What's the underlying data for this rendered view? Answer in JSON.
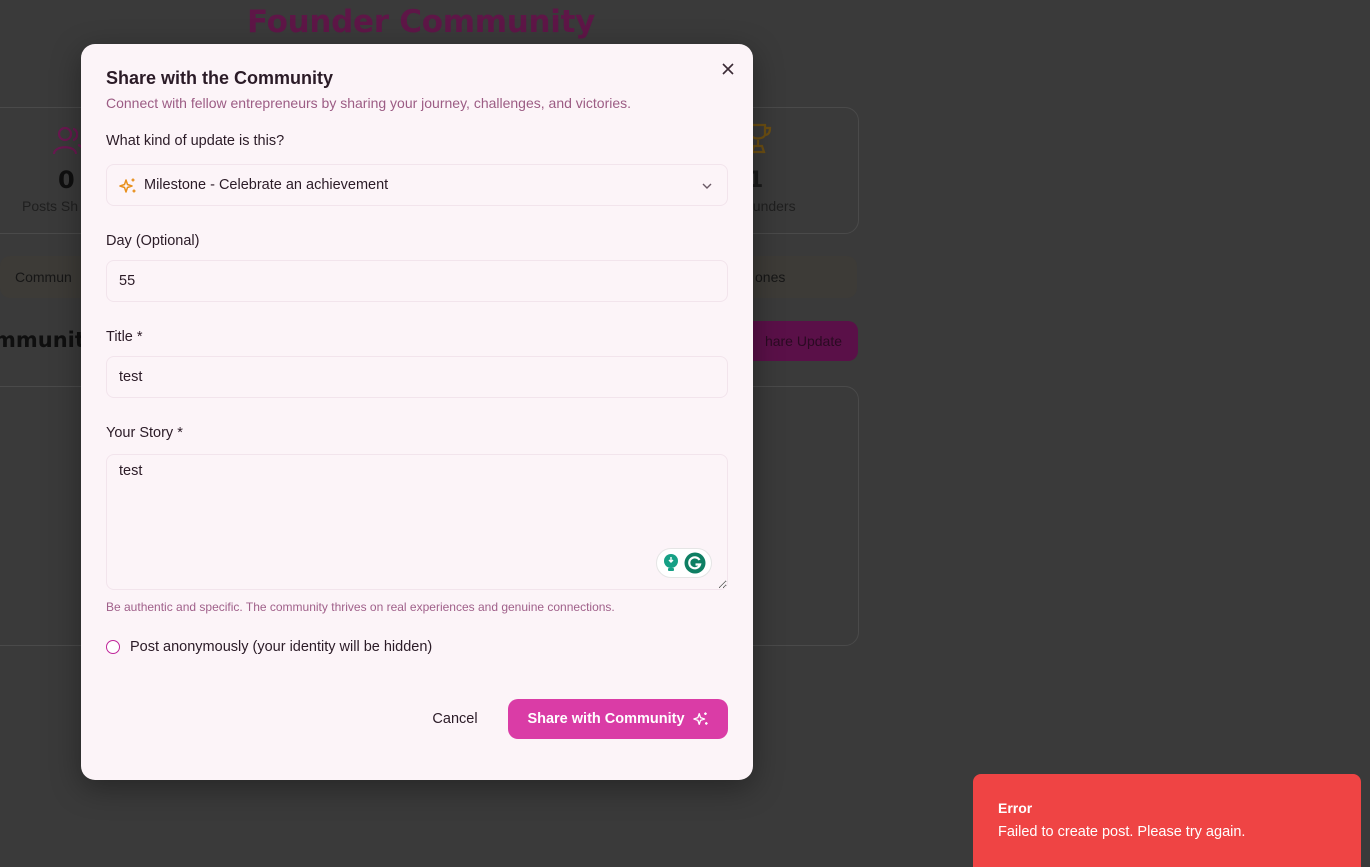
{
  "background": {
    "page_title": "Founder Community",
    "stats": {
      "left_value": "0",
      "left_label": "Posts Sh",
      "right_value": "1",
      "right_label": "ounders"
    },
    "tabs": {
      "left_label": "Commun",
      "right_label": "ones"
    },
    "section_title": "mmunity",
    "share_update_label": "hare Update"
  },
  "modal": {
    "title": "Share with the Community",
    "subtitle": "Connect with fellow entrepreneurs by sharing your journey, challenges, and victories.",
    "close_icon": "close-icon",
    "update_type": {
      "label": "What kind of update is this?",
      "selected": "Milestone - Celebrate an achievement",
      "icon": "sparkles-icon"
    },
    "day": {
      "label": "Day (Optional)",
      "value": "55"
    },
    "title_field": {
      "label": "Title *",
      "value": "test"
    },
    "story": {
      "label": "Your Story *",
      "value": "test"
    },
    "hint": "Be authentic and specific. The community thrives on real experiences and genuine connections.",
    "anonymous_label": "Post anonymously (your identity will be hidden)",
    "cancel_label": "Cancel",
    "submit_label": "Share with Community"
  },
  "toast": {
    "title": "Error",
    "message": "Failed to create post. Please try again."
  },
  "colors": {
    "accent": "#da3ca6",
    "modal_bg": "#fcf4f8",
    "error": "#ef4444",
    "subtitle": "#9c5c84"
  }
}
